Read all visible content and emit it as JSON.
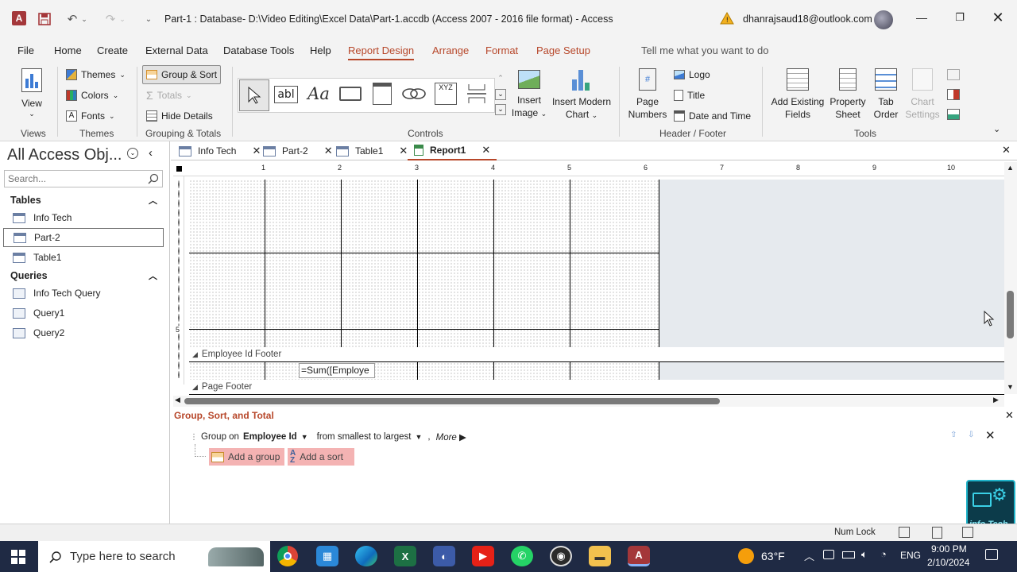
{
  "titlebar": {
    "title": "Part-1 : Database- D:\\Video Editing\\Excel Data\\Part-1.accdb (Access 2007 - 2016 file format)  -  Access",
    "account": "dhanrajsaud18@outlook.com",
    "app_icon": "A"
  },
  "ribbon_tabs": [
    "File",
    "Home",
    "Create",
    "External Data",
    "Database Tools",
    "Help",
    "Report Design",
    "Arrange",
    "Format",
    "Page Setup"
  ],
  "active_tab": "Report Design",
  "tell_me": "Tell me what you want to do",
  "ribbon": {
    "views": {
      "view": "View",
      "label": "Views"
    },
    "themes": {
      "themes": "Themes",
      "colors": "Colors",
      "fonts": "Fonts",
      "label": "Themes"
    },
    "grouping": {
      "group_sort": "Group & Sort",
      "totals": "Totals",
      "hide_details": "Hide Details",
      "label": "Grouping & Totals"
    },
    "controls": {
      "label": "Controls",
      "insert_image": "Insert",
      "insert_image2": "Image",
      "insert_chart": "Insert Modern",
      "insert_chart2": "Chart"
    },
    "header_footer": {
      "page_numbers": "Page",
      "page_numbers2": "Numbers",
      "logo": "Logo",
      "title": "Title",
      "date_time": "Date and Time",
      "label": "Header / Footer"
    },
    "tools": {
      "add_fields": "Add Existing",
      "add_fields2": "Fields",
      "property": "Property",
      "property2": "Sheet",
      "tab_order": "Tab",
      "tab_order2": "Order",
      "chart_settings": "Chart",
      "chart_settings2": "Settings",
      "label": "Tools"
    }
  },
  "nav": {
    "title": "All Access Obj...",
    "search_placeholder": "Search...",
    "tables_header": "Tables",
    "tables": [
      "Info Tech",
      "Part-2",
      "Table1"
    ],
    "queries_header": "Queries",
    "queries": [
      "Info Tech Query",
      "Query1",
      "Query2"
    ]
  },
  "doc_tabs": [
    "Info Tech",
    "Part-2",
    "Table1",
    "Report1"
  ],
  "active_doc": "Report1",
  "ruler": [
    "1",
    "2",
    "3",
    "4",
    "5",
    "6",
    "7",
    "8",
    "9",
    "10"
  ],
  "vruler": [
    "5"
  ],
  "design": {
    "section_footer": "Employee Id Footer",
    "section_page_footer": "Page Footer",
    "sum_field": "=Sum([Employe"
  },
  "group_sort": {
    "title": "Group, Sort, and Total",
    "group_on": "Group on",
    "field": "Employee Id",
    "order": "from smallest to largest",
    "more": "More ▶",
    "add_group": "Add a group",
    "add_sort": "Add a sort"
  },
  "status": {
    "num_lock": "Num Lock"
  },
  "watermark": "info Tech",
  "taskbar": {
    "search": "Type here to search",
    "weather": "63°F",
    "lang": "ENG",
    "time": "9:00 PM",
    "date": "2/10/2024"
  },
  "colors": {
    "accent": "#b7472a",
    "taskbar": "#1f2a44"
  }
}
